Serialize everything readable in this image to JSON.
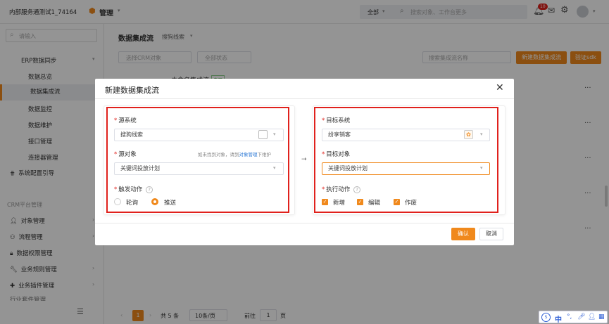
{
  "topbar": {
    "title": "内部服务通测试1_74164",
    "module": "管理",
    "scope": "全部",
    "search_placeholder": "搜索对象、工作台更多",
    "badge": "10"
  },
  "sidebar": {
    "search_placeholder": "请输入",
    "group": "ERP数据同步",
    "items": [
      "数据总览",
      "数据集成流",
      "数据监控",
      "数据维护",
      "接口管理",
      "连接器管理"
    ],
    "config": "系统配置引导",
    "section2": "CRM平台管理",
    "items2": [
      "对象管理",
      "流程管理",
      "数据权限管理",
      "业务规则管理",
      "业务插件管理",
      "行业套件管理"
    ]
  },
  "main": {
    "title": "数据集成流",
    "subtitle": "搜狗线索",
    "filter1": "选择CRM对象",
    "filter2": "全部状态",
    "search_placeholder": "搜索集成流名称",
    "btn_new": "新建数据集成流",
    "btn_sdk": "验证sdk",
    "row_title": "未命名集成流",
    "row_tag": "启用",
    "more": "···"
  },
  "pagination": {
    "current": "1",
    "total": "共 5 条",
    "page_size": "10条/页",
    "goto_label": "前往",
    "goto_value": "1",
    "page_unit": "页"
  },
  "dialog": {
    "title": "新建数据集成流",
    "source": {
      "system_label": "源系统",
      "system_value": "搜狗线索",
      "object_label": "源对象",
      "object_hint_pre": "如未找到对象，请到",
      "object_hint_link": "对象管理",
      "object_hint_post": "下维护",
      "object_value": "关键词投放计划",
      "trigger_label": "触发动作",
      "options": [
        "轮询",
        "推送"
      ],
      "selected": "推送"
    },
    "target": {
      "system_label": "目标系统",
      "system_value": "纷享销客",
      "object_label": "目标对象",
      "object_value": "关键词投放计划",
      "action_label": "执行动作",
      "actions": [
        "新增",
        "编辑",
        "作废"
      ]
    },
    "arrow": "→",
    "confirm": "确认",
    "cancel": "取消"
  },
  "ime": {
    "lang": "中"
  }
}
